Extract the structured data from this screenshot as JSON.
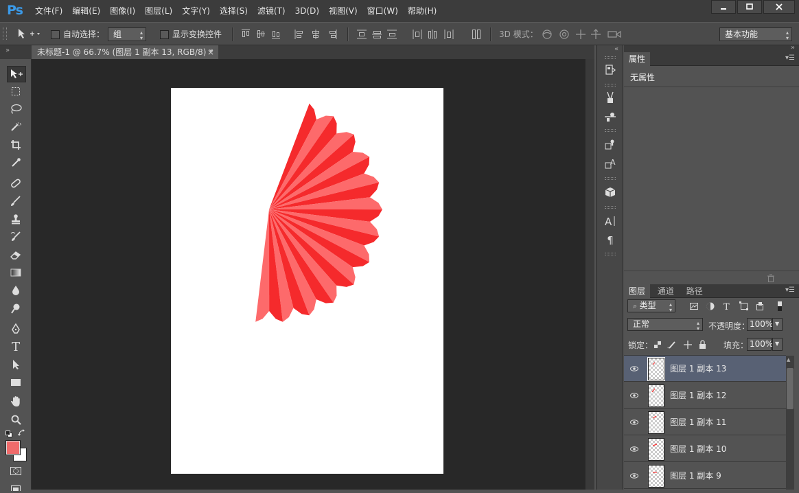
{
  "app": {
    "logo": "Ps"
  },
  "menu": [
    "文件(F)",
    "编辑(E)",
    "图像(I)",
    "图层(L)",
    "文字(Y)",
    "选择(S)",
    "滤镜(T)",
    "3D(D)",
    "视图(V)",
    "窗口(W)",
    "帮助(H)"
  ],
  "options": {
    "auto_select_label": "自动选择：",
    "auto_select_value": "组",
    "show_transform_label": "显示变换控件",
    "mode3d_label": "3D 模式：",
    "workspace_value": "基本功能"
  },
  "document": {
    "tab_title": "未标题-1 @ 66.7% (图层 1 副本 13, RGB/8) *",
    "close": "×"
  },
  "colors": {
    "foreground": "#f06b6b",
    "background": "#ffffff",
    "fan_dark": "#f52a2c",
    "fan_light": "#fd6a6b",
    "selection": "#586174"
  },
  "properties": {
    "tab": "属性",
    "empty_text": "无属性"
  },
  "layers": {
    "tabs": [
      "图层",
      "通道",
      "路径"
    ],
    "filter_kind": "类型",
    "blend_mode": "正常",
    "opacity_label": "不透明度：",
    "opacity_value": "100%",
    "lock_label": "锁定：",
    "fill_label": "填充：",
    "fill_value": "100%",
    "items": [
      {
        "name": "图层 1 副本 13",
        "selected": true
      },
      {
        "name": "图层 1 副本 12",
        "selected": false
      },
      {
        "name": "图层 1 副本 11",
        "selected": false
      },
      {
        "name": "图层 1 副本 10",
        "selected": false
      },
      {
        "name": "图层 1 副本 9",
        "selected": false
      }
    ]
  }
}
